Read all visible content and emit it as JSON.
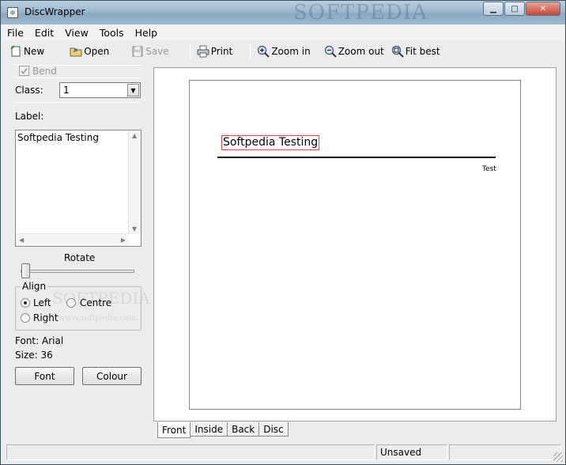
{
  "window": {
    "title": "DiscWrapper",
    "watermark": "SOFTPEDIA"
  },
  "window_controls": {
    "minimize": "▁",
    "maximize": "□",
    "close": "✕"
  },
  "menu": [
    "File",
    "Edit",
    "View",
    "Tools",
    "Help"
  ],
  "toolbar": {
    "new_label": "New",
    "open_label": "Open",
    "save_label": "Save",
    "print_label": "Print",
    "zoom_in_label": "Zoom in",
    "zoom_out_label": "Zoom out",
    "fit_best_label": "Fit best"
  },
  "panel": {
    "bend_label": "Bend",
    "bend_checked": true,
    "class_label": "Class:",
    "class_value": "1",
    "label_label": "Label:",
    "label_text": "Softpedia Testing",
    "rotate_label": "Rotate",
    "rotate_value": 0,
    "align_legend": "Align",
    "align_left": "Left",
    "align_centre": "Centre",
    "align_right": "Right",
    "align_selected": "Left",
    "font_info": "Font: Arial",
    "size_info": "Size: 36",
    "font_button": "Font",
    "colour_button": "Colour",
    "watermark_text": "SOFTPEDIA",
    "watermark_url": "www.softpedia.com"
  },
  "canvas": {
    "main_text": "Softpedia Testing",
    "small_text": "Test"
  },
  "tabs": [
    "Front",
    "Inside",
    "Back",
    "Disc"
  ],
  "status": {
    "state": "Unsaved"
  },
  "colors": {
    "selection_border": "#e04040",
    "titlebar": "#9db9cf"
  }
}
